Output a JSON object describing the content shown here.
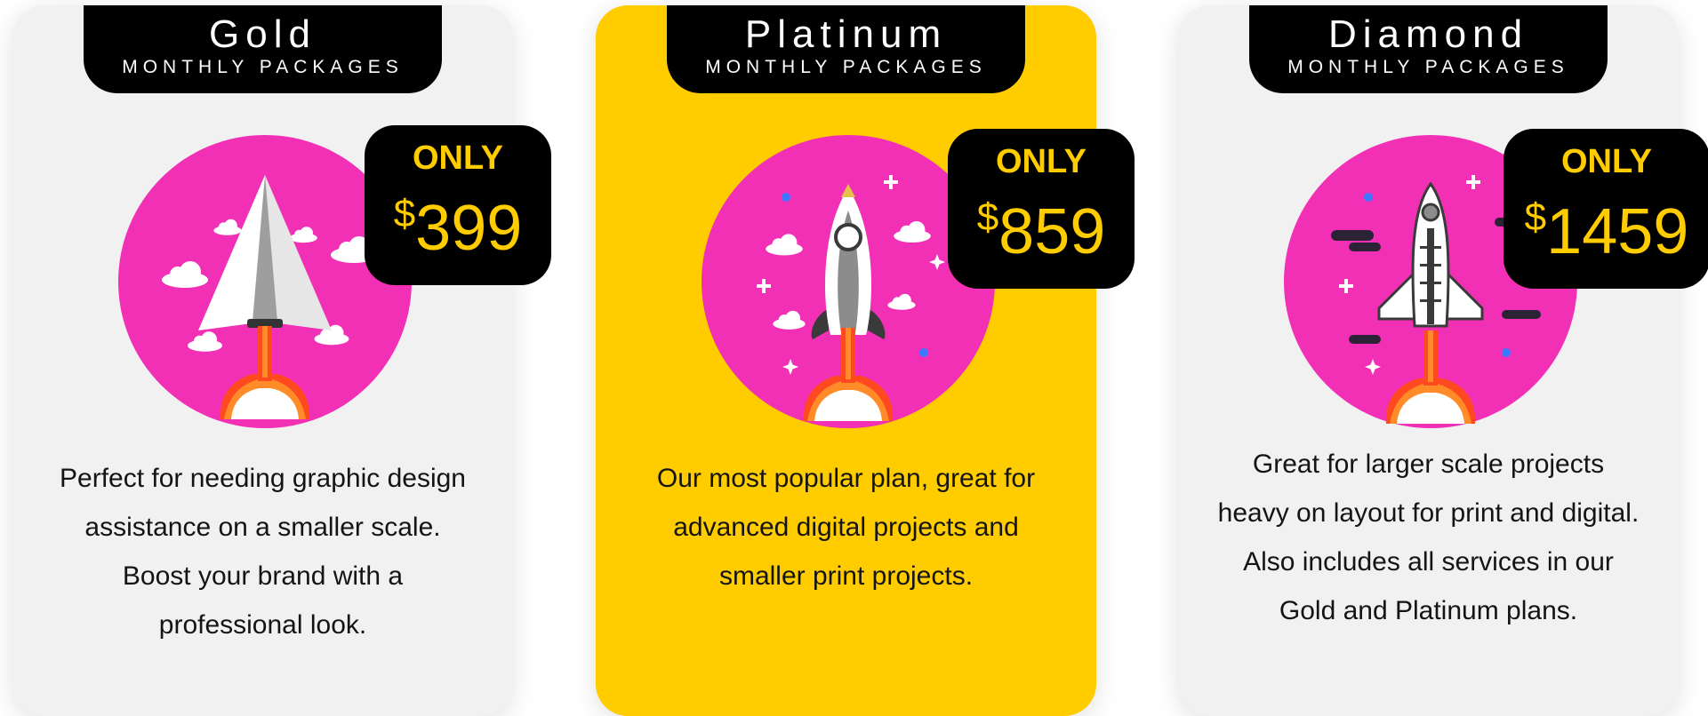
{
  "plans": [
    {
      "name": "Gold",
      "subtitle": "MONTHLY PACKAGES",
      "price_prefix": "ONLY",
      "currency": "$",
      "price": "399",
      "description": "Perfect for needing graphic design assistance on a smaller scale. Boost your brand with a professional look.",
      "card_color": "#f1f1f2",
      "illustration": "paper-plane-rocket"
    },
    {
      "name": "Platinum",
      "subtitle": "MONTHLY PACKAGES",
      "price_prefix": "ONLY",
      "currency": "$",
      "price": "859",
      "description": "Our most popular plan, great for advanced digital projects and smaller print projects.",
      "card_color": "#ffcc00",
      "illustration": "rocket"
    },
    {
      "name": "Diamond",
      "subtitle": "MONTHLY PACKAGES",
      "price_prefix": "ONLY",
      "currency": "$",
      "price": "1459",
      "description": "Great for larger scale projects heavy on layout for print and digital. Also includes all services in our Gold and Platinum plans.",
      "card_color": "#f1f1f2",
      "illustration": "space-shuttle"
    }
  ],
  "colors": {
    "accent": "#ffcc00",
    "badge": "#000000",
    "circle": "#f230b5"
  }
}
